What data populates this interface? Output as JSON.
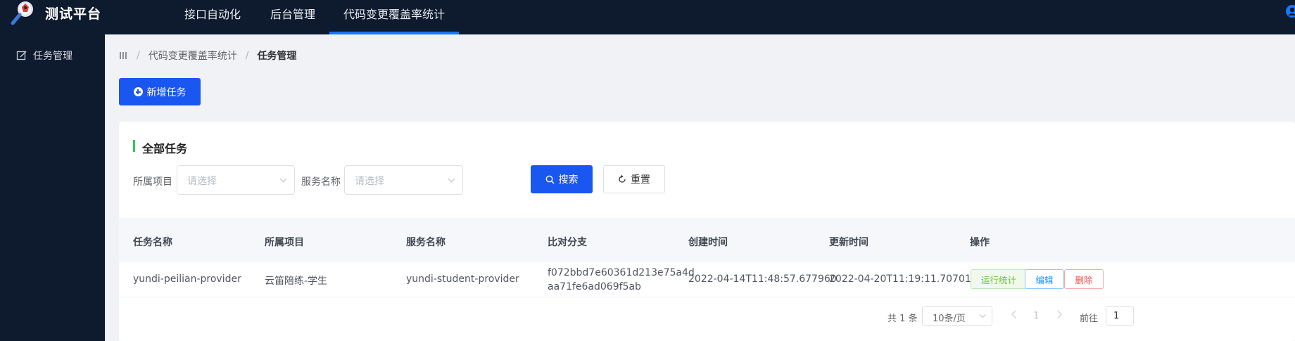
{
  "header": {
    "app_title": "测试平台",
    "nav": [
      {
        "label": "接口自动化"
      },
      {
        "label": "后台管理"
      },
      {
        "label": "代码变更覆盖率统计",
        "active": true
      }
    ],
    "accent_color": "#1677ff",
    "background_color": "#0e1a2d"
  },
  "sidebar": {
    "items": [
      {
        "label": "任务管理",
        "icon": "edit-icon"
      }
    ]
  },
  "breadcrumb": {
    "items": [
      "代码变更覆盖率统计",
      "任务管理"
    ],
    "menu_icon": "menu-icon"
  },
  "actions": {
    "add_task_label": "新增任务"
  },
  "card": {
    "title": "全部任务",
    "filters": {
      "project_label": "所属项目",
      "project_placeholder": "请选择",
      "service_label": "服务名称",
      "service_placeholder": "请选择",
      "search_label": "搜索",
      "reset_label": "重置"
    },
    "table": {
      "columns": [
        "任务名称",
        "所属项目",
        "服务名称",
        "比对分支",
        "创建时间",
        "更新时间",
        "操作"
      ],
      "rows": [
        {
          "task_name": "yundi-peilian-provider",
          "project": "云笛陪练-学生",
          "service": "yundi-student-provider",
          "branch": "f072bbd7e60361d213e75a4daa71fe6ad069f5ab",
          "created": "2022-04-14T11:48:57.677960",
          "updated": "2022-04-20T11:19:11.707015",
          "actions": {
            "run": "运行统计",
            "edit": "编辑",
            "delete": "删除"
          }
        }
      ]
    },
    "pagination": {
      "total_text": "共 1 条",
      "page_size": "10条/页",
      "current_page": "1",
      "goto_label": "前往",
      "goto_value": "1"
    }
  },
  "colors": {
    "primary_button": "#1a56f0",
    "title_bar": "#33c65a",
    "run_tag": "#67c23a",
    "edit_tag": "#1890ff",
    "delete_tag": "#f05050"
  }
}
